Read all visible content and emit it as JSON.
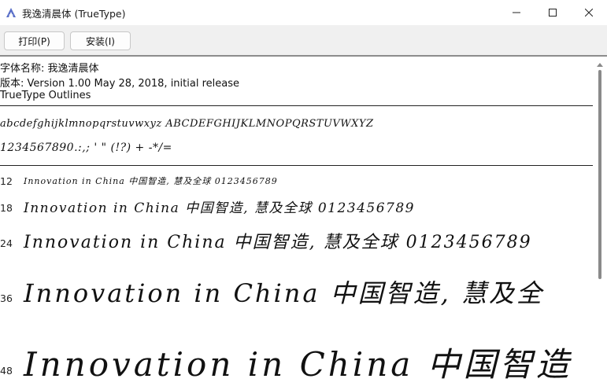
{
  "window": {
    "title": "我逸清晨体 (TrueType)",
    "app_icon": "font-viewer-icon",
    "controls": {
      "minimize": "minimize-icon",
      "maximize": "maximize-icon",
      "close": "close-icon"
    }
  },
  "toolbar": {
    "print_label": "打印(P)",
    "install_label": "安装(I)"
  },
  "font_info": {
    "name_line": "字体名称: 我逸清晨体",
    "version_line": "版本: Version 1.00 May 28, 2018, initial release",
    "outline_line": "TrueType Outlines"
  },
  "character_set": {
    "letters": "abcdefghijklmnopqrstuvwxyz ABCDEFGHIJKLMNOPQRSTUVWXYZ",
    "digits_symbols": "1234567890.:,; ' \" (!?) + -*/="
  },
  "samples": [
    {
      "size": "12",
      "text": "Innovation in China 中国智造, 慧及全球 0123456789"
    },
    {
      "size": "18",
      "text": "Innovation in China 中国智造, 慧及全球 0123456789"
    },
    {
      "size": "24",
      "text": "Innovation in China 中国智造, 慧及全球 0123456789"
    },
    {
      "size": "36",
      "text": "Innovation in China 中国智造, 慧及全"
    },
    {
      "size": "48",
      "text": "Innovation in China 中国智造"
    }
  ]
}
